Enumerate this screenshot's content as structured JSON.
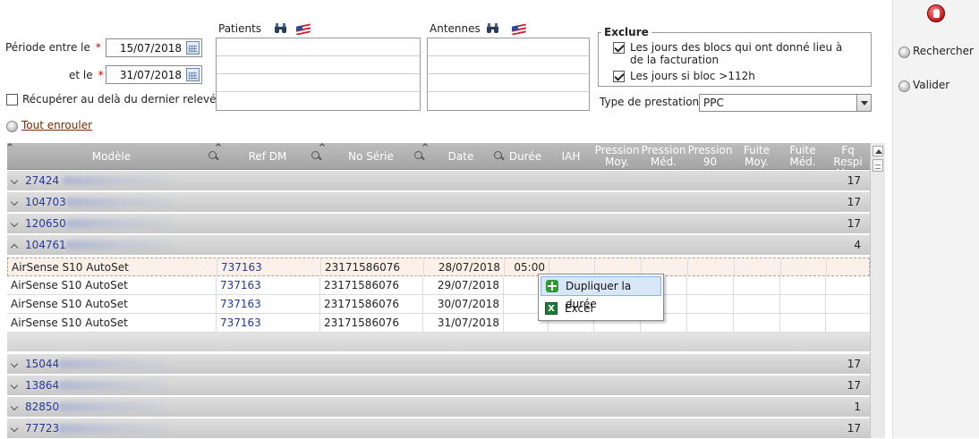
{
  "filters": {
    "period_label": "Période entre le",
    "and_label": "et le",
    "required_mark": "*",
    "date_from": "15/07/2018",
    "date_to": "31/07/2018",
    "recover_label": "Récupérer au delà du dernier relevé",
    "collapse_all": "Tout enrouler",
    "patients_label": "Patients",
    "antennas_label": "Antennes",
    "exclude": {
      "title": "Exclure",
      "option1": "Les jours des blocs qui ont donné lieu à de la facturation",
      "option1_checked": true,
      "option2": "Les jours si bloc >112h",
      "option2_checked": true
    },
    "service_type_label": "Type de prestation",
    "service_type_value": "PPC"
  },
  "actions": {
    "search": "Rechercher",
    "validate": "Valider"
  },
  "grid": {
    "headers": {
      "model": "Modèle",
      "ref_dm": "Ref DM",
      "serial": "No Série",
      "date": "Date",
      "duration": "Durée",
      "iah": "IAH",
      "pressure_avg": "Pression Moy.",
      "pressure_med": "Pression Méd.",
      "pressure_90": "Pression 90",
      "leak_avg": "Fuite Moy.",
      "leak_med": "Fuite Méd.",
      "freq_resp": "Fq Respi Moy."
    },
    "groups_top": [
      {
        "id": "27424",
        "count": "17"
      },
      {
        "id": "104703",
        "count": "17"
      },
      {
        "id": "120650",
        "count": "17"
      }
    ],
    "expanded_group": {
      "id": "104761",
      "count": "4"
    },
    "rows": [
      {
        "model": "AirSense S10 AutoSet",
        "ref": "737163",
        "serial": "23171586076",
        "date": "28/07/2018",
        "duration": "05:00"
      },
      {
        "model": "AirSense S10 AutoSet",
        "ref": "737163",
        "serial": "23171586076",
        "date": "29/07/2018",
        "duration": ""
      },
      {
        "model": "AirSense S10 AutoSet",
        "ref": "737163",
        "serial": "23171586076",
        "date": "30/07/2018",
        "duration": ""
      },
      {
        "model": "AirSense S10 AutoSet",
        "ref": "737163",
        "serial": "23171586076",
        "date": "31/07/2018",
        "duration": ""
      }
    ],
    "groups_bottom": [
      {
        "id": "15044",
        "count": "17"
      },
      {
        "id": "13864",
        "count": "17"
      },
      {
        "id": "82850",
        "count": "1"
      },
      {
        "id": "77723",
        "count": "17"
      }
    ]
  },
  "context_menu": {
    "duplicate": "Dupliquer la durée",
    "excel": "Excel"
  },
  "icons": {
    "stop": "stop-hand-icon",
    "binoculars": "binoculars-icon",
    "eraser": "eraser-icon"
  }
}
